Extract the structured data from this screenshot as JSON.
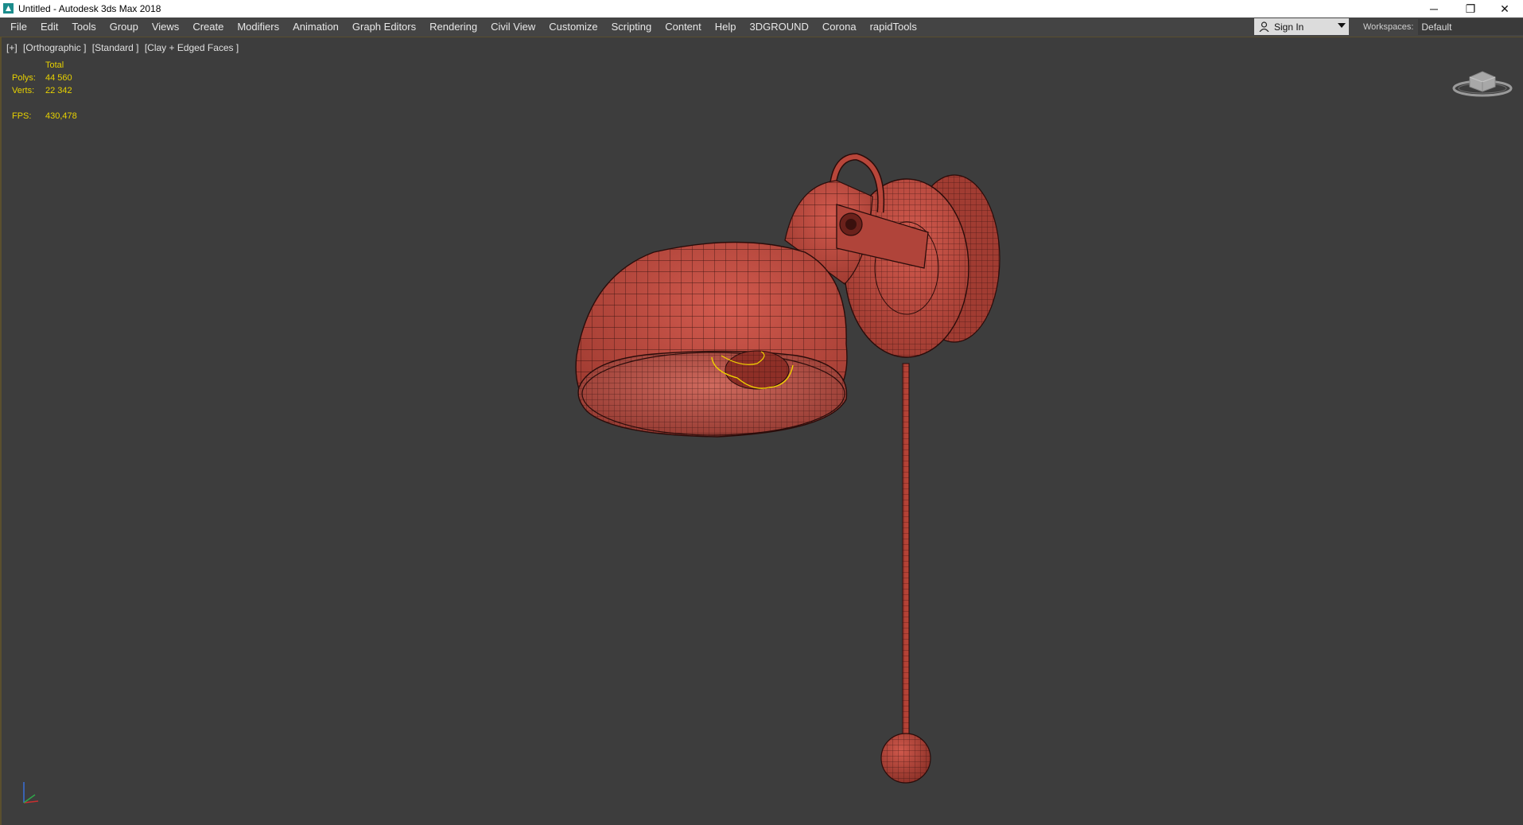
{
  "window": {
    "title": "Untitled - Autodesk 3ds Max 2018",
    "minimize_glyph": "─",
    "restore_glyph": "❐",
    "close_glyph": "✕"
  },
  "menu": [
    "File",
    "Edit",
    "Tools",
    "Group",
    "Views",
    "Create",
    "Modifiers",
    "Animation",
    "Graph Editors",
    "Rendering",
    "Civil View",
    "Customize",
    "Scripting",
    "Content",
    "Help",
    "3DGROUND",
    "Corona",
    "rapidTools"
  ],
  "signin": {
    "label": "Sign In",
    "icon": "user-icon"
  },
  "workspaces": {
    "label": "Workspaces:",
    "value": "Default"
  },
  "viewport": {
    "label_plus": "[+]",
    "label_view": "[Orthographic ]",
    "label_shading": "[Standard ]",
    "label_mode": "[Clay + Edged Faces ]",
    "stats": {
      "header": "Total",
      "polys_label": "Polys:",
      "polys_value": "44 560",
      "verts_label": "Verts:",
      "verts_value": "22 342",
      "fps_label": "FPS:",
      "fps_value": "430,478"
    },
    "model": {
      "name": "wall-lamp-mesh",
      "color": "#c0463c",
      "wire_color": "#2a0c0a",
      "selection_color": "#f0d000"
    }
  },
  "colors": {
    "menubar": "#444444",
    "viewport_bg": "#3d3d3d",
    "stats_text": "#e8d200"
  }
}
